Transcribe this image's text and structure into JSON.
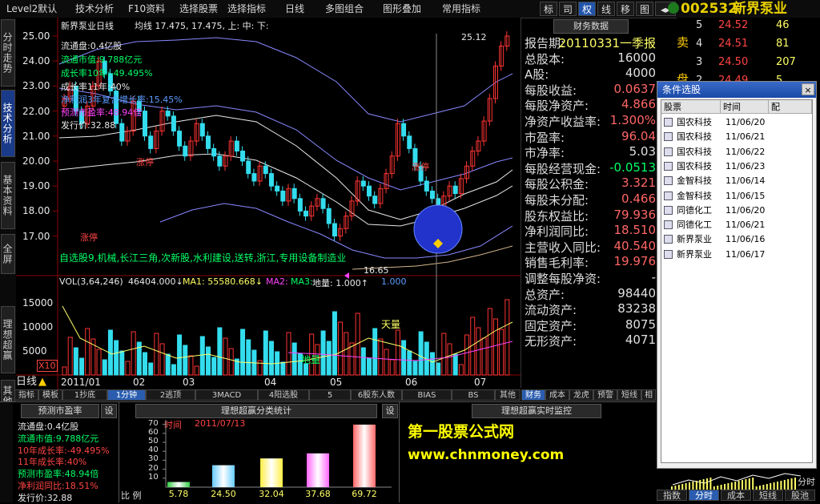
{
  "menu": {
    "items": [
      "Level2默认",
      "技术分析",
      "F10资料",
      "选择股票",
      "选择指标",
      "日线",
      "多图组合",
      "图形叠加",
      "常用指标"
    ],
    "toolbar_buttons": [
      "标",
      "司",
      "权",
      "线",
      "移",
      "图"
    ],
    "stock_code": "002532",
    "stock_name": "新界泵业"
  },
  "left_rail": [
    "分时走势",
    "技术分析",
    "基本资料",
    "全屏",
    "理想超赢",
    "其他"
  ],
  "chart": {
    "title": "新界泵业日线",
    "ma_legend": "均线 17.475, 17.475, 上: 中: 下:",
    "y_ticks": [
      "25.00",
      "24.00",
      "23.00",
      "22.00",
      "21.00",
      "20.00",
      "19.00",
      "18.00",
      "17.00"
    ],
    "info_lines": [
      {
        "text": "流通盘:0.4亿股",
        "color": "#e8e8e8"
      },
      {
        "text": "流通市值:9.788亿元",
        "color": "#00ff66"
      },
      {
        "text": "成长率10年:-49.495%",
        "color": "#00ff66"
      },
      {
        "text": "成长率11年:40%",
        "color": "#e8e8e8"
      },
      {
        "text": "净利润3年复合增长率:15.45%",
        "color": "#5b9bff"
      },
      {
        "text": "预测市盈率:48.94倍",
        "color": "#ff44ff"
      },
      {
        "text": "发行价:32.88",
        "color": "#e8e8e8"
      }
    ],
    "labels": {
      "zhangting1": "涨停",
      "zhangting2": "涨停",
      "zhangting3": "涨停",
      "high_value": "25.12",
      "low_value": "16.65",
      "concept_text": "自选股9,机械,长江三角,次新股,水利建设,送转,浙江,专用设备制造业"
    },
    "vol_legend": {
      "head": "VOL(3,64,246)",
      "v1": "46404.000↓",
      "ma1": "MA1: 55580.668↓",
      "ma2": "MA2:",
      "ma3": "MA3:",
      "diliang": "地量: 1.000↑",
      "tail": "1.000"
    },
    "vol_ticks": [
      "15000",
      "10000",
      "5000"
    ],
    "vol_unit": "X10",
    "tianliang": "天量",
    "diliang_mark": "地量",
    "period_label": "日线",
    "dates": [
      "2011/01",
      "02",
      "03",
      "04",
      "05",
      "06",
      "07"
    ]
  },
  "quote": {
    "rows": [
      {
        "idx": "5",
        "price": "24.52",
        "vol": "46"
      },
      {
        "idx": "4",
        "price": "24.51",
        "vol": "81"
      },
      {
        "idx": "3",
        "price": "24.50",
        "vol": "207"
      },
      {
        "idx": "2",
        "price": "24.49",
        "vol": "5"
      }
    ],
    "side_sell": "卖",
    "side_buy": "盘"
  },
  "fin": {
    "header": "财务数据",
    "rows": [
      {
        "k": "报告期:",
        "v": "20110331一季报",
        "vc": "#ffff66"
      },
      {
        "k": "总股本:",
        "v": "16000",
        "vc": "#e0e0e0"
      },
      {
        "k": "A股:",
        "v": "4000",
        "vc": "#e0e0e0"
      },
      {
        "k": "每股收益:",
        "v": "0.0637",
        "vc": "#ff6666"
      },
      {
        "k": "每股净资产:",
        "v": "4.866",
        "vc": "#ff6666"
      },
      {
        "k": "净资产收益率:",
        "v": "1.300%",
        "vc": "#ff6666"
      },
      {
        "k": "市盈率:",
        "v": "96.04",
        "vc": "#ff6666"
      },
      {
        "k": "市净率:",
        "v": "5.03",
        "vc": "#e0e0e0"
      },
      {
        "k": "每股经营现金:",
        "v": "-0.0513",
        "vc": "#00ff66"
      },
      {
        "k": "每股公积金:",
        "v": "3.321",
        "vc": "#ff6666"
      },
      {
        "k": "每股未分配:",
        "v": "0.466",
        "vc": "#ff6666"
      },
      {
        "k": "股东权益比:",
        "v": "79.936",
        "vc": "#ff6666"
      },
      {
        "k": "净利润同比:",
        "v": "18.510",
        "vc": "#ff6666"
      },
      {
        "k": "主营收入同比:",
        "v": "40.540",
        "vc": "#ff6666"
      },
      {
        "k": "销售毛利率:",
        "v": "19.976",
        "vc": "#ff6666"
      },
      {
        "k": "调整每股净资:",
        "v": "-",
        "vc": "#e0e0e0"
      },
      {
        "k": "总资产:",
        "v": "98440",
        "vc": "#e0e0e0"
      },
      {
        "k": "流动资产:",
        "v": "83238",
        "vc": "#e0e0e0"
      },
      {
        "k": "固定资产:",
        "v": "8075",
        "vc": "#e0e0e0"
      },
      {
        "k": "无形资产:",
        "v": "4071",
        "vc": "#e0e0e0"
      }
    ],
    "tabs": [
      "财务",
      "成本",
      "龙虎",
      "预警",
      "短线",
      "相"
    ]
  },
  "popup": {
    "title": "条件选股",
    "close": "×",
    "col_stock": "股票",
    "col_time": "时间",
    "col_match": "配",
    "rows": [
      {
        "name": "国农科技",
        "time": "11/06/20"
      },
      {
        "name": "国农科技",
        "time": "11/06/21"
      },
      {
        "name": "国农科技",
        "time": "11/06/22"
      },
      {
        "name": "国农科技",
        "time": "11/06/23"
      },
      {
        "name": "金智科技",
        "time": "11/06/14"
      },
      {
        "name": "金智科技",
        "time": "11/06/15"
      },
      {
        "name": "同德化工",
        "time": "11/06/20"
      },
      {
        "name": "同德化工",
        "time": "11/06/21"
      },
      {
        "name": "新界泵业",
        "time": "11/06/16"
      },
      {
        "name": "新界泵业",
        "time": "11/06/17"
      }
    ]
  },
  "bottom_tabs": [
    "指标",
    "模板",
    "1抄底",
    "1分钟",
    "2逃顶",
    "3MACD",
    "4阳选股",
    "5",
    "6股东人数",
    "BIAS",
    "BS",
    "其他"
  ],
  "left_panel": {
    "title": "预测市盈率",
    "set": "设",
    "rows": [
      {
        "text": "流通盘:0.4亿股",
        "color": "#e8e8e8"
      },
      {
        "text": "流通市值:9.788亿元",
        "color": "#00ff66"
      },
      {
        "text": "10年成长率:-49.495%",
        "color": "#ff4444"
      },
      {
        "text": "11年成长率:40%",
        "color": "#ff4444"
      },
      {
        "text": "预测市盈率:48.94倍",
        "color": "#00ff66"
      },
      {
        "text": "净利润同比:18.51%",
        "color": "#ff4444"
      },
      {
        "text": "发行价:32.88",
        "color": "#e8e8e8"
      }
    ]
  },
  "mid_panel": {
    "title": "理想超赢分类统计",
    "set": "设",
    "time_label": "时间",
    "time_value": "2011/07/13",
    "y_ticks": [
      "70",
      "60",
      "50",
      "40",
      "30",
      "20",
      "10"
    ],
    "xlabel": "比 例",
    "bars": [
      5.78,
      24.5,
      32.04,
      37.68,
      69.72
    ],
    "bar_labels": [
      "5.78",
      "24.50",
      "32.04",
      "37.68",
      "69.72"
    ],
    "bar_colors": [
      "#33cc44",
      "#66ccff",
      "#ffee44",
      "#ff66ff",
      "#ff6666"
    ]
  },
  "right_panel": {
    "title": "理想超赢实时监控",
    "watermark1": "第一股票公式网",
    "watermark2": "www.chnmoney.com"
  },
  "bottom_right_tabs": [
    "指数",
    "分时",
    "成本",
    "短线",
    "股池"
  ],
  "bottom_right_label": "分时"
}
